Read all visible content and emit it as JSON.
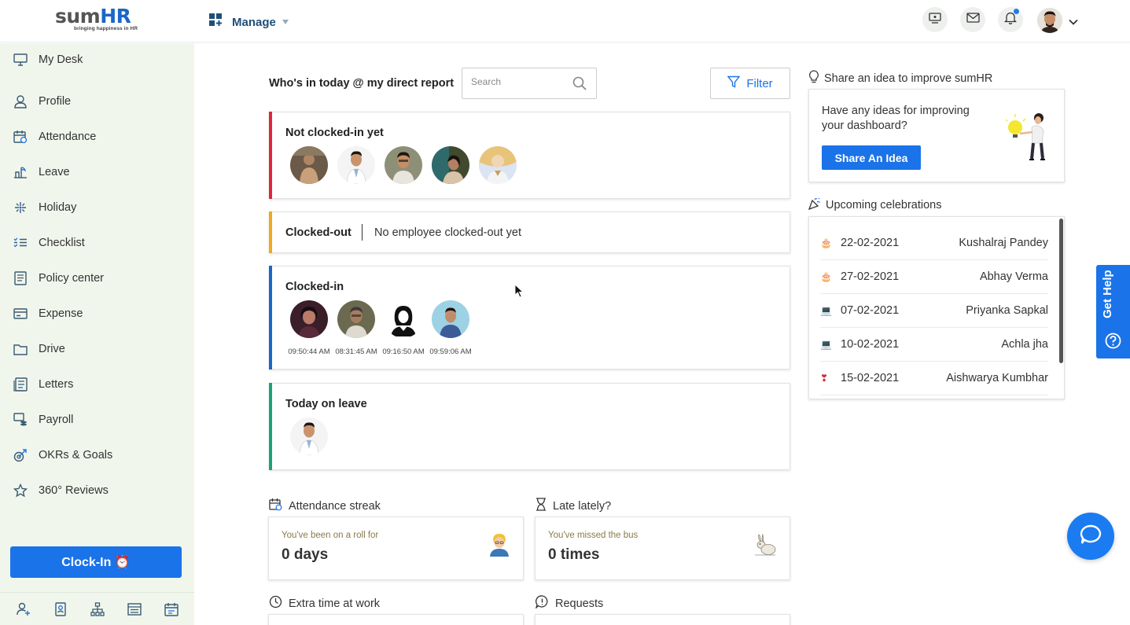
{
  "header": {
    "logo_main": "sum",
    "logo_hr": "HR",
    "logo_tagline": "bringing happiness in HR",
    "manage_label": "Manage"
  },
  "sidebar": {
    "items": [
      {
        "label": "My Desk",
        "icon": "monitor-icon"
      },
      {
        "label": "Profile",
        "icon": "user-icon"
      },
      {
        "label": "Attendance",
        "icon": "calendar-clock-icon"
      },
      {
        "label": "Leave",
        "icon": "leave-icon"
      },
      {
        "label": "Holiday",
        "icon": "sparkle-icon"
      },
      {
        "label": "Checklist",
        "icon": "checklist-icon"
      },
      {
        "label": "Policy center",
        "icon": "document-icon"
      },
      {
        "label": "Expense",
        "icon": "card-icon"
      },
      {
        "label": "Drive",
        "icon": "folder-icon"
      },
      {
        "label": "Letters",
        "icon": "letters-icon"
      },
      {
        "label": "Payroll",
        "icon": "payroll-icon"
      },
      {
        "label": "OKRs & Goals",
        "icon": "goals-icon"
      },
      {
        "label": "360° Reviews",
        "icon": "star-icon"
      }
    ],
    "clockin_label": "Clock-In ⏰"
  },
  "main": {
    "who_title": "Who's in today @ my direct report",
    "search_placeholder": "Search",
    "filter_label": "Filter",
    "not_clocked_title": "Not clocked-in yet",
    "clocked_out_title": "Clocked-out",
    "clocked_out_empty": "No employee clocked-out yet",
    "clocked_in_title": "Clocked-in",
    "clocked_in_times": [
      "09:50:44 AM",
      "08:31:45 AM",
      "09:16:50 AM",
      "09:59:06 AM"
    ],
    "on_leave_title": "Today on leave"
  },
  "stats": {
    "streak_title": "Attendance streak",
    "streak_sub": "You've been on a roll for",
    "streak_value": "0 days",
    "late_title": "Late lately?",
    "late_sub": "You've missed the bus",
    "late_value": "0 times",
    "extra_title": "Extra time at work",
    "requests_title": "Requests"
  },
  "right": {
    "idea_title": "Share an idea to improve sumHR",
    "idea_text": "Have any ideas for improving your dashboard?",
    "idea_button": "Share An Idea",
    "celeb_title": "Upcoming celebrations",
    "celebrations": [
      {
        "emoji": "🎂",
        "date": "22-02-2021",
        "name": "Kushalraj Pandey"
      },
      {
        "emoji": "🎂",
        "date": "27-02-2021",
        "name": "Abhay Verma"
      },
      {
        "emoji": "💻",
        "date": "07-02-2021",
        "name": "Priyanka Sapkal"
      },
      {
        "emoji": "💻",
        "date": "10-02-2021",
        "name": "Achla jha"
      },
      {
        "emoji": "❣",
        "date": "15-02-2021",
        "name": "Aishwarya Kumbhar"
      }
    ]
  },
  "get_help_label": "Get Help",
  "colors": {
    "primary": "#1a73e8",
    "not_clocked_bar": "#e0253a",
    "clocked_out_bar": "#f0a81e",
    "clocked_in_bar": "#1a66c9",
    "on_leave_bar": "#1aa37a",
    "sidebar_bg": "#f1f6ed"
  }
}
